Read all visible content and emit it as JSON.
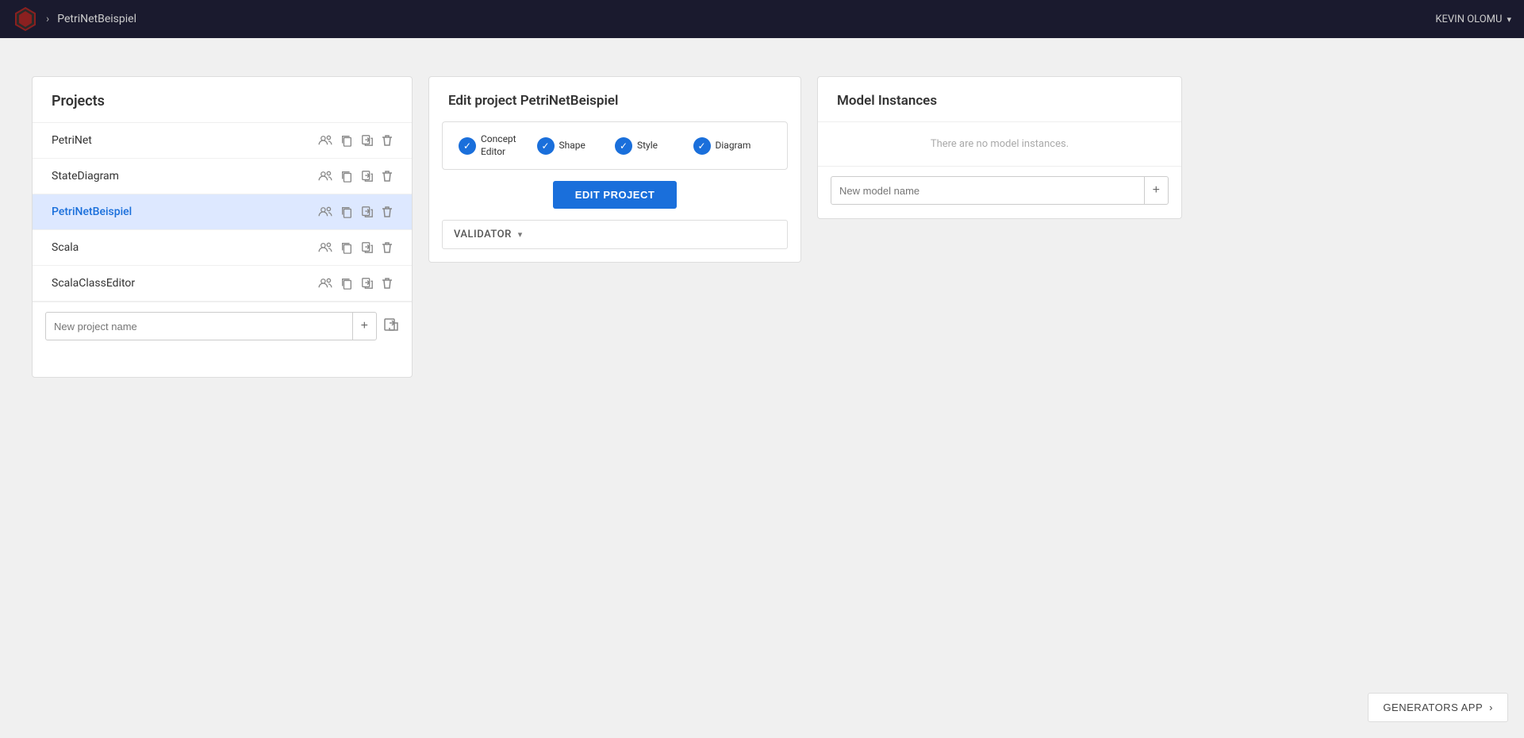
{
  "app": {
    "logo_color": "#8B2020"
  },
  "topnav": {
    "breadcrumb_chevron": "›",
    "breadcrumb_text": "PetriNetBeispiel",
    "user_name": "KEVIN OLOMU",
    "user_chevron": "▾"
  },
  "projects_panel": {
    "title": "Projects",
    "projects": [
      {
        "name": "PetriNet",
        "active": false
      },
      {
        "name": "StateDiagram",
        "active": false
      },
      {
        "name": "PetriNetBeispiel",
        "active": true
      },
      {
        "name": "Scala",
        "active": false
      },
      {
        "name": "ScalaClassEditor",
        "active": false
      }
    ],
    "new_project_placeholder": "New project name",
    "add_icon": "+"
  },
  "edit_panel": {
    "title": "Edit project PetriNetBeispiel",
    "steps": [
      {
        "label": "Concept\nEditor",
        "checked": true
      },
      {
        "label": "Shape",
        "checked": true
      },
      {
        "label": "Style",
        "checked": true
      },
      {
        "label": "Diagram",
        "checked": true
      }
    ],
    "edit_button_label": "EDIT PROJECT",
    "validator_label": "VALIDATOR",
    "validator_chevron": "▾"
  },
  "model_panel": {
    "title": "Model Instances",
    "no_instances_text": "There are no model instances.",
    "new_model_placeholder": "New model name",
    "add_icon": "+"
  },
  "generators_btn": {
    "label": "GENERATORS APP",
    "chevron": "›"
  }
}
